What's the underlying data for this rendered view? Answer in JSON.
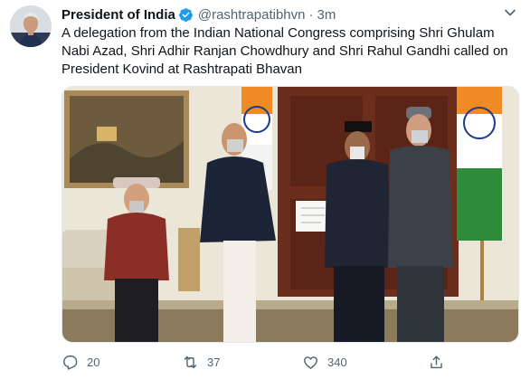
{
  "author": {
    "name": "President of India",
    "handle": "@rashtrapatibhvn",
    "time": "3m"
  },
  "tweet": {
    "text": "A delegation from the Indian National Congress comprising Shri Ghulam Nabi Azad, Shri Adhir Ranjan Chowdhury and Shri Rahul Gandhi called on President Kovind at Rashtrapati Bhavan"
  },
  "actions": {
    "replies": "20",
    "retweets": "37",
    "likes": "340"
  },
  "colors": {
    "accent": "#1d9bf0",
    "secondary_text": "#536471"
  }
}
